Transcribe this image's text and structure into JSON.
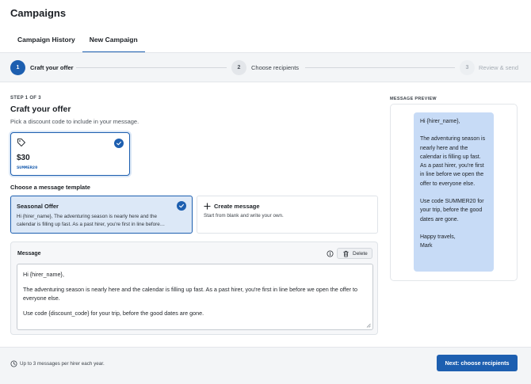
{
  "page": {
    "title": "Campaigns"
  },
  "tabs": [
    {
      "label": "Campaign History",
      "active": false
    },
    {
      "label": "New Campaign",
      "active": true
    }
  ],
  "stepper": {
    "steps": [
      {
        "number": "1",
        "label": "Craft your offer",
        "state": "active"
      },
      {
        "number": "2",
        "label": "Choose recipients",
        "state": "todo"
      },
      {
        "number": "3",
        "label": "Review & send",
        "state": "upcoming"
      }
    ]
  },
  "form": {
    "step_count": "STEP 1 OF 3",
    "title": "Craft your offer",
    "subtitle": "Pick a discount code to include in your message."
  },
  "discount_code": {
    "amount": "$30",
    "code": "SUMMER20",
    "selected": true,
    "icon": "tag-icon"
  },
  "templates": {
    "heading": "Choose a message template",
    "seasonal": {
      "title": "Seasonal Offer",
      "line1": "Hi {hirer_name}, The adventuring season is nearly here and the",
      "line2": "calendar is filling up fast. As a past hirer, you're first in line before…",
      "selected": true
    },
    "create": {
      "title": "Create message",
      "subtitle": "Start from blank and write your own.",
      "icon": "plus-icon"
    }
  },
  "message": {
    "label": "Message",
    "delete_label": "Delete",
    "greeting": "Hi {hirer_name},",
    "body": "The adventuring season is nearly here and the calendar is filling up fast. As a past hirer, you're first in line before we open the offer to everyone else.",
    "closing": "Use code {discount_code} for your trip, before the good dates are gone."
  },
  "preview": {
    "label": "MESSAGE PREVIEW",
    "greeting": "Hi {hirer_name},",
    "body": "The adventuring season is nearly here and the calendar is filling up fast. As a past hirer, you're first in line before we open the offer to everyone else.",
    "code_line": "Use code SUMMER20 for your trip, before the good dates are gone.",
    "signoff": "Happy travels,",
    "signature": "Mark"
  },
  "footer": {
    "note": "Up to 3 messages per hirer each year.",
    "next_label": "Next: choose recipients"
  },
  "colors": {
    "accent": "#1d5fb0",
    "selected_bg": "#dce8f7",
    "bubble_bg": "#c7dbf6",
    "bar_bg": "#f3f5f7"
  }
}
